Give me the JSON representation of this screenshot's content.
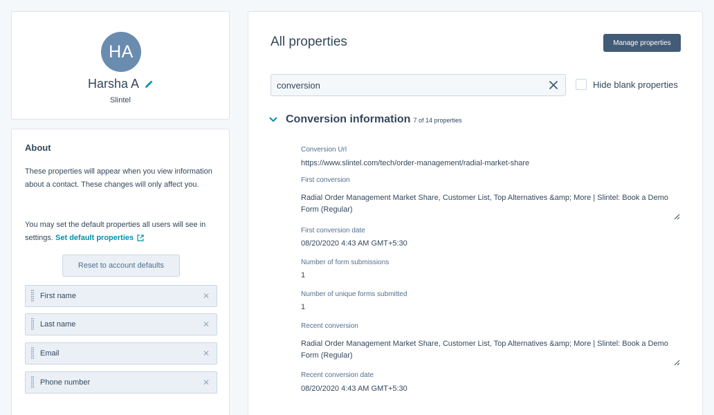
{
  "profile": {
    "initials": "HA",
    "name": "Harsha A",
    "company": "Slintel"
  },
  "about": {
    "title": "About",
    "paragraph1": "These properties will appear when you view information about a contact. These changes will only affect you.",
    "paragraph2_prefix": "You may set the default properties all users will see in settings.",
    "set_default_link": "Set default properties",
    "reset_button": "Reset to account defaults",
    "properties": [
      {
        "label": "First name"
      },
      {
        "label": "Last name"
      },
      {
        "label": "Email"
      },
      {
        "label": "Phone number"
      }
    ]
  },
  "main": {
    "title": "All properties",
    "manage_button": "Manage properties",
    "search": {
      "value": "conversion"
    },
    "hide_blank_label": "Hide blank properties",
    "hide_blank_checked": false,
    "section": {
      "title": "Conversion information",
      "count": "7 of 14 properties",
      "fields": [
        {
          "label": "Conversion Url",
          "value": "https://www.slintel.com/tech/order-management/radial-market-share"
        },
        {
          "label": "First conversion",
          "value": "Radial Order Management Market Share, Customer List, Top Alternatives &amp; More | Slintel: Book a Demo Form (Regular)"
        },
        {
          "label": "First conversion date",
          "value": "08/20/2020 4:43 AM GMT+5:30"
        },
        {
          "label": "Number of form submissions",
          "value": "1"
        },
        {
          "label": "Number of unique forms submitted",
          "value": "1"
        },
        {
          "label": "Recent conversion",
          "value": "Radial Order Management Market Share, Customer List, Top Alternatives &amp; More | Slintel: Book a Demo Form (Regular)"
        },
        {
          "label": "Recent conversion date",
          "value": "08/20/2020 4:43 AM GMT+5:30"
        }
      ]
    }
  },
  "icons": {
    "edit": "pencil-icon",
    "external": "external-link-icon",
    "drag": "drag-handle-icon",
    "remove": "close-icon",
    "clear": "clear-search-icon",
    "chevron": "chevron-down-icon"
  },
  "colors": {
    "accent": "#0091ae",
    "primary_button": "#425b76",
    "avatar": "#6a8caf"
  }
}
